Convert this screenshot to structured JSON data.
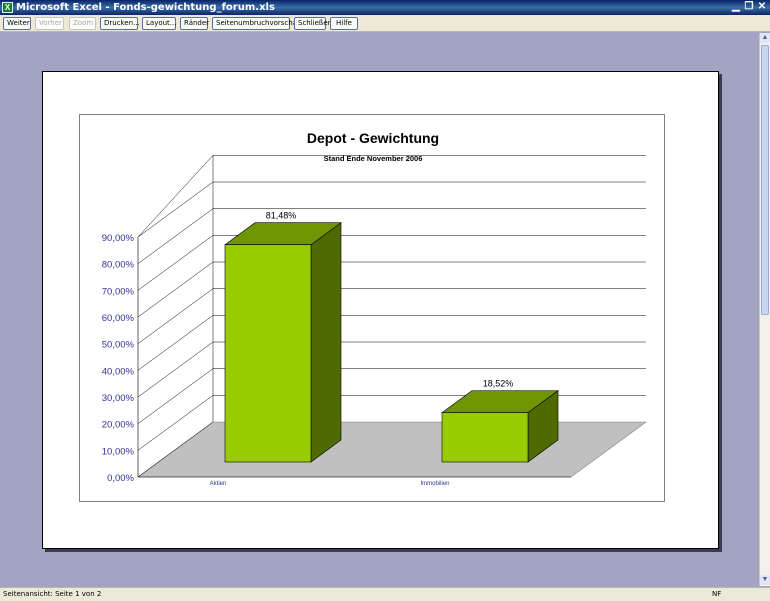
{
  "window": {
    "title": "Microsoft Excel - Fonds-gewichtung_forum.xls",
    "app_icon": "excel-icon",
    "controls": [
      "minimize-icon",
      "restore-icon",
      "close-icon"
    ]
  },
  "toolbar": {
    "next": "Weiter",
    "previous": "Vorher",
    "zoom": "Zoom",
    "print": "Drucken...",
    "setup": "Layout...",
    "margins": "Ränder",
    "page_break_preview": "Seitenumbruchvorschau",
    "close": "Schließen",
    "help": "Hilfe"
  },
  "status": {
    "left": "Seitenansicht: Seite 1 von 2",
    "right": "NF"
  },
  "chart_data": {
    "type": "bar",
    "title": "Depot - Gewichtung",
    "subtitle": "Stand Ende November 2006",
    "categories": [
      "Aktien",
      "Immobilien"
    ],
    "values": [
      81.48,
      18.52
    ],
    "data_labels": [
      "81,48%",
      "18,52%"
    ],
    "ylim": [
      0,
      90
    ],
    "y_ticks": [
      "0,00%",
      "10,00%",
      "20,00%",
      "30,00%",
      "40,00%",
      "50,00%",
      "60,00%",
      "70,00%",
      "80,00%",
      "90,00%"
    ],
    "xlabel": "",
    "ylabel": "",
    "grid": true,
    "legend": "none",
    "colors": {
      "front": "#99cc00",
      "top": "#6f9600",
      "side": "#4d6b00",
      "floor": "#c0c0c0",
      "axis_text": "#333399"
    }
  }
}
